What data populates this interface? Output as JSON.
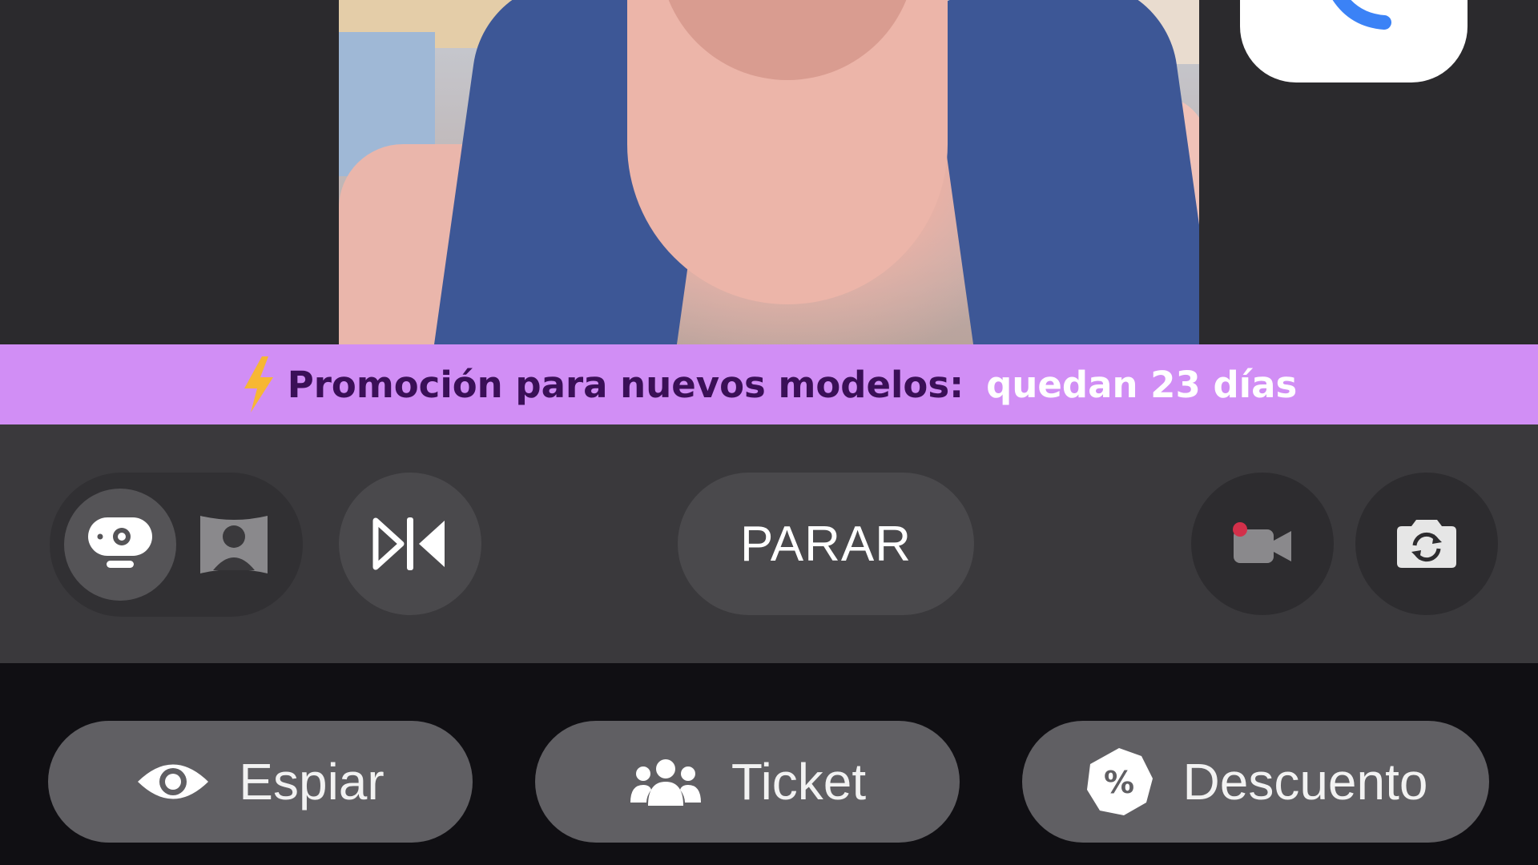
{
  "promo": {
    "icon": "lightning-icon",
    "label": "Promoción para nuevos modelos:",
    "remaining": "quedan 23 días",
    "background": "#d18ef5"
  },
  "controls": {
    "stop_label": "PARAR",
    "toggle": {
      "options": [
        "webcam-icon",
        "user-portrait-icon"
      ],
      "selected": "webcam-icon"
    },
    "mirror_icon": "mirror-flip-icon",
    "record_icon": "record-video-icon",
    "switch_camera_icon": "switch-camera-icon"
  },
  "actions": {
    "spy_label": "Espiar",
    "ticket_label": "Ticket",
    "discount_label": "Descuento"
  },
  "colors": {
    "accent_purple": "#d18ef5",
    "record_dot": "#d3304a",
    "phone_blue": "#3b82f6"
  }
}
